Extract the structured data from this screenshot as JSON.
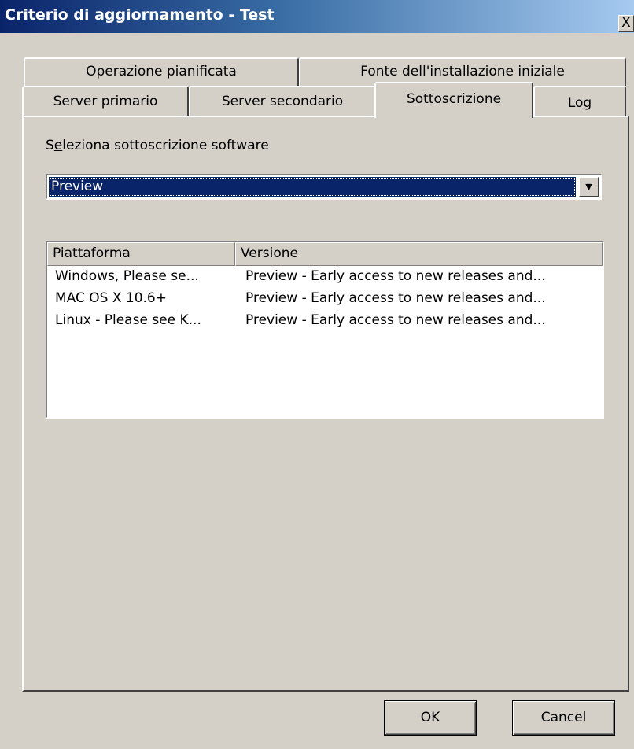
{
  "window": {
    "title": "Criterio di aggiornamento - Test",
    "close_label": "X"
  },
  "tabs": {
    "row_top": [
      {
        "label": "Operazione pianificata"
      },
      {
        "label": "Fonte dell'installazione iniziale"
      }
    ],
    "row_bottom": [
      {
        "label": "Server primario"
      },
      {
        "label": "Server secondario"
      },
      {
        "label": "Sottoscrizione",
        "active": true
      },
      {
        "label": "Log"
      }
    ]
  },
  "subscription": {
    "label_prefix": "S",
    "label_mnemonic": "e",
    "label_rest": "leziona sottoscrizione software",
    "selected": "Preview"
  },
  "list": {
    "columns": [
      "Piattaforma",
      "Versione"
    ],
    "rows": [
      {
        "platform": "Windows, Please se...",
        "version": "Preview - Early access to new releases and..."
      },
      {
        "platform": "MAC OS X 10.6+",
        "version": "Preview - Early access to new releases and..."
      },
      {
        "platform": "Linux - Please see K...",
        "version": "Preview - Early access to new releases and..."
      }
    ]
  },
  "buttons": {
    "ok": "OK",
    "cancel": "Cancel"
  },
  "colors": {
    "titlebar_start": "#0a246a",
    "titlebar_end": "#a6caf0",
    "face": "#d4d0c8",
    "selection": "#0a246a"
  },
  "icons": {
    "close": "close-icon",
    "dropdown": "chevron-down-icon"
  }
}
